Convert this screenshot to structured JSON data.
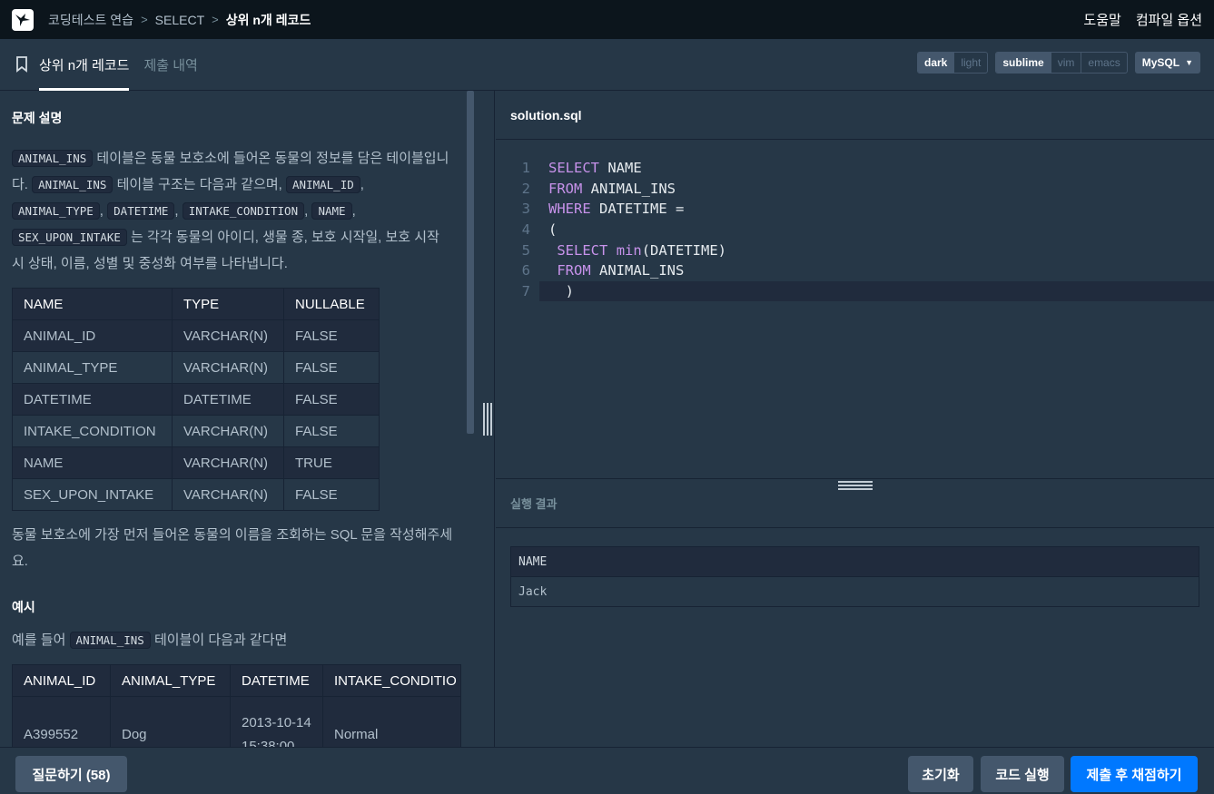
{
  "breadcrumb": [
    "코딩테스트 연습",
    "SELECT",
    "상위 n개 레코드"
  ],
  "header": {
    "help": "도움말",
    "compile_options": "컴파일 옵션"
  },
  "tabs": [
    {
      "label": "상위 n개 레코드"
    },
    {
      "label": "제출 내역"
    }
  ],
  "theme": {
    "options": [
      "dark",
      "light"
    ],
    "selected": "dark"
  },
  "keymap": {
    "options": [
      "sublime",
      "vim",
      "emacs"
    ],
    "selected": "sublime"
  },
  "language": "MySQL",
  "problem": {
    "section_title": "문제 설명",
    "desc_parts": [
      "ANIMAL_INS",
      " 테이블은 동물 보호소에 들어온 동물의 정보를 담은 테이블입니다. ",
      "ANIMAL_INS",
      " 테이블 구조는 다음과 같으며, ",
      "ANIMAL_ID",
      ", ",
      "ANIMAL_TYPE",
      ", ",
      "DATETIME",
      ", ",
      "INTAKE_CONDITION",
      ", ",
      "NAME",
      ", ",
      "SEX_UPON_INTAKE",
      " 는 각각 동물의 아이디, 생물 종, 보호 시작일, 보호 시작 시 상태, 이름, 성별 및 중성화 여부를 나타냅니다."
    ],
    "schema_headers": [
      "NAME",
      "TYPE",
      "NULLABLE"
    ],
    "schema_rows": [
      [
        "ANIMAL_ID",
        "VARCHAR(N)",
        "FALSE"
      ],
      [
        "ANIMAL_TYPE",
        "VARCHAR(N)",
        "FALSE"
      ],
      [
        "DATETIME",
        "DATETIME",
        "FALSE"
      ],
      [
        "INTAKE_CONDITION",
        "VARCHAR(N)",
        "FALSE"
      ],
      [
        "NAME",
        "VARCHAR(N)",
        "TRUE"
      ],
      [
        "SEX_UPON_INTAKE",
        "VARCHAR(N)",
        "FALSE"
      ]
    ],
    "question": "동물 보호소에 가장 먼저 들어온 동물의 이름을 조회하는 SQL 문을 작성해주세요.",
    "example_title": "예시",
    "example_intro_pre": "예를 들어 ",
    "example_intro_code": "ANIMAL_INS",
    "example_intro_post": " 테이블이 다음과 같다면",
    "example_headers": [
      "ANIMAL_ID",
      "ANIMAL_TYPE",
      "DATETIME",
      "INTAKE_CONDITIO"
    ],
    "example_row": [
      "A399552",
      "Dog",
      "2013-10-14 15:38:00",
      "Normal"
    ]
  },
  "editor": {
    "filename": "solution.sql",
    "lines": [
      {
        "n": "1",
        "tokens": [
          [
            "kw",
            "SELECT"
          ],
          [
            "tx",
            " NAME"
          ]
        ]
      },
      {
        "n": "2",
        "tokens": [
          [
            "kw",
            "FROM"
          ],
          [
            "tx",
            " ANIMAL_INS"
          ]
        ]
      },
      {
        "n": "3",
        "tokens": [
          [
            "kw",
            "WHERE"
          ],
          [
            "tx",
            " DATETIME ="
          ]
        ]
      },
      {
        "n": "4",
        "tokens": [
          [
            "tx",
            "("
          ]
        ]
      },
      {
        "n": "5",
        "tokens": [
          [
            "tx",
            " "
          ],
          [
            "kw",
            "SELECT"
          ],
          [
            "tx",
            " "
          ],
          [
            "fn",
            "min"
          ],
          [
            "tx",
            "(DATETIME)"
          ]
        ]
      },
      {
        "n": "6",
        "tokens": [
          [
            "tx",
            " "
          ],
          [
            "kw",
            "FROM"
          ],
          [
            "tx",
            " ANIMAL_INS"
          ]
        ]
      },
      {
        "n": "7",
        "tokens": [
          [
            "tx",
            "  )"
          ]
        ]
      }
    ]
  },
  "results": {
    "title": "실행 결과",
    "headers": [
      "NAME"
    ],
    "rows": [
      [
        "Jack"
      ]
    ]
  },
  "footer": {
    "questions": "질문하기 (58)",
    "reset": "초기화",
    "run": "코드 실행",
    "submit": "제출 후 채점하기"
  }
}
